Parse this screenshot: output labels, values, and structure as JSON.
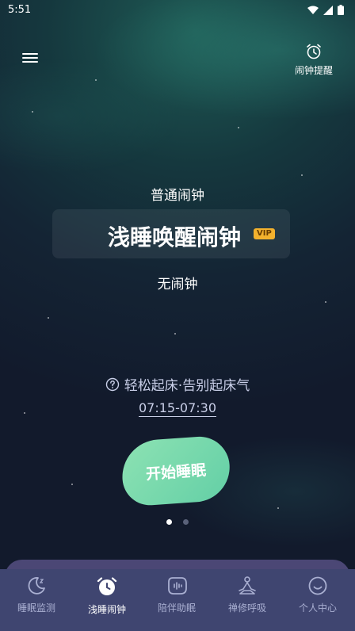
{
  "status_bar": {
    "time": "5:51"
  },
  "header": {
    "alarm_reminder_label": "闹钟提醒"
  },
  "modes": {
    "normal": "普通闹钟",
    "light_sleep": "浅睡唤醒闹钟",
    "vip_badge": "VIP",
    "none": "无闹钟"
  },
  "tagline": "轻松起床·告别起床气",
  "time_range": "07:15-07:30",
  "start_button": "开始睡眠",
  "pagination": {
    "active_index": 0,
    "count": 2
  },
  "nav": {
    "items": [
      {
        "label": "睡眠监测",
        "icon": "moon-icon"
      },
      {
        "label": "浅睡闹钟",
        "icon": "alarm-clock-icon"
      },
      {
        "label": "陪伴助眠",
        "icon": "sound-wave-icon"
      },
      {
        "label": "禅修呼吸",
        "icon": "meditation-icon"
      },
      {
        "label": "个人中心",
        "icon": "smile-icon"
      }
    ],
    "active_index": 1
  },
  "colors": {
    "accent_green": "#63cfa6",
    "vip": "#f3b12d",
    "nav_bg": "#3f4570"
  }
}
